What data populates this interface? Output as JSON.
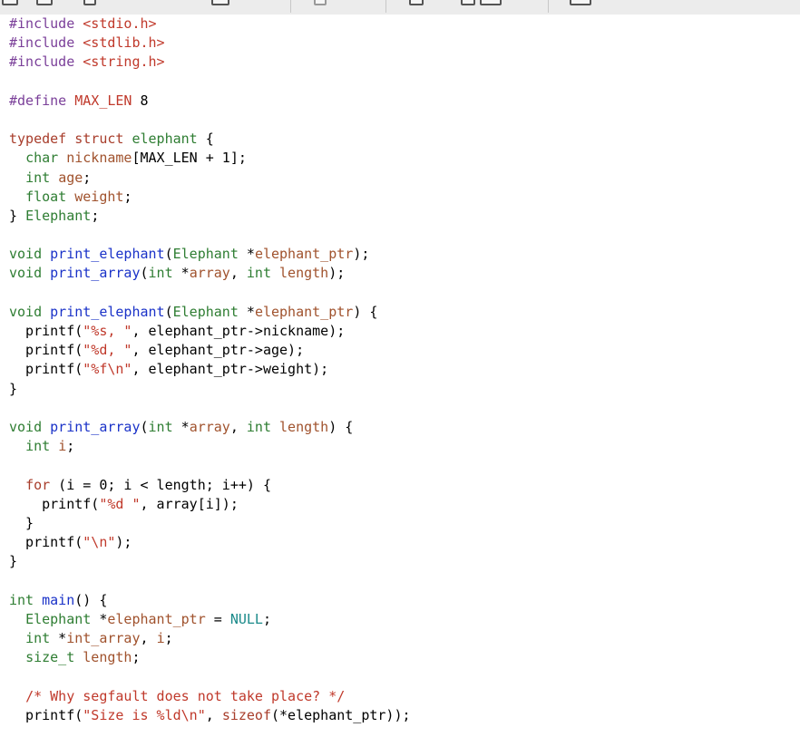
{
  "toolbar": {
    "icons": [
      "new-file-icon",
      "open-folder-icon",
      "save-icon",
      "print-icon",
      "undo-icon",
      "search-icon",
      "find-replace-icon",
      "replace-icon",
      "fullscreen-icon"
    ]
  },
  "code_lines": [
    [
      [
        "pp",
        "#include "
      ],
      [
        "str",
        "<stdio.h>"
      ]
    ],
    [
      [
        "pp",
        "#include "
      ],
      [
        "str",
        "<stdlib.h>"
      ]
    ],
    [
      [
        "pp",
        "#include "
      ],
      [
        "str",
        "<string.h>"
      ]
    ],
    [],
    [
      [
        "pp",
        "#define "
      ],
      [
        "str",
        "MAX_LEN"
      ],
      [
        "txt",
        " 8"
      ]
    ],
    [],
    [
      [
        "kw",
        "typedef struct "
      ],
      [
        "ty",
        "elephant"
      ],
      [
        "txt",
        " {"
      ]
    ],
    [
      [
        "txt",
        "  "
      ],
      [
        "ty",
        "char "
      ],
      [
        "id",
        "nickname"
      ],
      [
        "txt",
        "[MAX_LEN + 1];"
      ]
    ],
    [
      [
        "txt",
        "  "
      ],
      [
        "ty",
        "int "
      ],
      [
        "id",
        "age"
      ],
      [
        "txt",
        ";"
      ]
    ],
    [
      [
        "txt",
        "  "
      ],
      [
        "ty",
        "float "
      ],
      [
        "id",
        "weight"
      ],
      [
        "txt",
        ";"
      ]
    ],
    [
      [
        "txt",
        "} "
      ],
      [
        "ty",
        "Elephant"
      ],
      [
        "txt",
        ";"
      ]
    ],
    [],
    [
      [
        "ty",
        "void "
      ],
      [
        "fn",
        "print_elephant"
      ],
      [
        "txt",
        "("
      ],
      [
        "ty",
        "Elephant"
      ],
      [
        "txt",
        " *"
      ],
      [
        "id",
        "elephant_ptr"
      ],
      [
        "txt",
        ");"
      ]
    ],
    [
      [
        "ty",
        "void "
      ],
      [
        "fn",
        "print_array"
      ],
      [
        "txt",
        "("
      ],
      [
        "ty",
        "int"
      ],
      [
        "txt",
        " *"
      ],
      [
        "id",
        "array"
      ],
      [
        "txt",
        ", "
      ],
      [
        "ty",
        "int "
      ],
      [
        "id",
        "length"
      ],
      [
        "txt",
        ");"
      ]
    ],
    [],
    [
      [
        "ty",
        "void "
      ],
      [
        "fn",
        "print_elephant"
      ],
      [
        "txt",
        "("
      ],
      [
        "ty",
        "Elephant"
      ],
      [
        "txt",
        " *"
      ],
      [
        "id",
        "elephant_ptr"
      ],
      [
        "txt",
        ") {"
      ]
    ],
    [
      [
        "txt",
        "  printf("
      ],
      [
        "str",
        "\"%s, \""
      ],
      [
        "txt",
        ", elephant_ptr->nickname);"
      ]
    ],
    [
      [
        "txt",
        "  printf("
      ],
      [
        "str",
        "\"%d, \""
      ],
      [
        "txt",
        ", elephant_ptr->age);"
      ]
    ],
    [
      [
        "txt",
        "  printf("
      ],
      [
        "str",
        "\"%f\\n\""
      ],
      [
        "txt",
        ", elephant_ptr->weight);"
      ]
    ],
    [
      [
        "txt",
        "}"
      ]
    ],
    [],
    [
      [
        "ty",
        "void "
      ],
      [
        "fn",
        "print_array"
      ],
      [
        "txt",
        "("
      ],
      [
        "ty",
        "int"
      ],
      [
        "txt",
        " *"
      ],
      [
        "id",
        "array"
      ],
      [
        "txt",
        ", "
      ],
      [
        "ty",
        "int "
      ],
      [
        "id",
        "length"
      ],
      [
        "txt",
        ") {"
      ]
    ],
    [
      [
        "txt",
        "  "
      ],
      [
        "ty",
        "int "
      ],
      [
        "id",
        "i"
      ],
      [
        "txt",
        ";"
      ]
    ],
    [],
    [
      [
        "txt",
        "  "
      ],
      [
        "kw",
        "for"
      ],
      [
        "txt",
        " (i = 0; i < length; i++) {"
      ]
    ],
    [
      [
        "txt",
        "    printf("
      ],
      [
        "str",
        "\"%d \""
      ],
      [
        "txt",
        ", array[i]);"
      ]
    ],
    [
      [
        "txt",
        "  }"
      ]
    ],
    [
      [
        "txt",
        "  printf("
      ],
      [
        "str",
        "\"\\n\""
      ],
      [
        "txt",
        ");"
      ]
    ],
    [
      [
        "txt",
        "}"
      ]
    ],
    [],
    [
      [
        "ty",
        "int "
      ],
      [
        "fn",
        "main"
      ],
      [
        "txt",
        "() {"
      ]
    ],
    [
      [
        "txt",
        "  "
      ],
      [
        "ty",
        "Elephant"
      ],
      [
        "txt",
        " *"
      ],
      [
        "id",
        "elephant_ptr"
      ],
      [
        "txt",
        " = "
      ],
      [
        "const",
        "NULL"
      ],
      [
        "txt",
        ";"
      ]
    ],
    [
      [
        "txt",
        "  "
      ],
      [
        "ty",
        "int"
      ],
      [
        "txt",
        " *"
      ],
      [
        "id",
        "int_array"
      ],
      [
        "txt",
        ", "
      ],
      [
        "id",
        "i"
      ],
      [
        "txt",
        ";"
      ]
    ],
    [
      [
        "txt",
        "  "
      ],
      [
        "ty",
        "size_t "
      ],
      [
        "id",
        "length"
      ],
      [
        "txt",
        ";"
      ]
    ],
    [],
    [
      [
        "txt",
        "  "
      ],
      [
        "cm",
        "/* Why segfault does not take place? */"
      ]
    ],
    [
      [
        "txt",
        "  printf("
      ],
      [
        "str",
        "\"Size is %ld\\n\""
      ],
      [
        "txt",
        ", "
      ],
      [
        "kw",
        "sizeof"
      ],
      [
        "txt",
        "(*elephant_ptr));"
      ]
    ]
  ]
}
